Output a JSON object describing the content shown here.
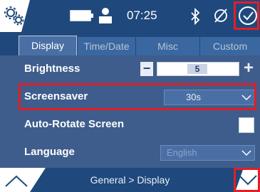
{
  "status_bar": {
    "time": "07:25",
    "icons": [
      "gears-icon",
      "battery-icon",
      "user-icon",
      "bluetooth-icon",
      "no-signal-icon",
      "check-circle-icon"
    ]
  },
  "tabs": [
    {
      "label": "Display",
      "active": true
    },
    {
      "label": "Time/Date",
      "active": false
    },
    {
      "label": "Misc",
      "active": false
    },
    {
      "label": "Custom",
      "active": false
    }
  ],
  "settings": {
    "brightness": {
      "label": "Brightness",
      "value": "5",
      "minus": "−",
      "plus": "+"
    },
    "screensaver": {
      "label": "Screensaver",
      "value": "30s"
    },
    "auto_rotate": {
      "label": "Auto-Rotate Screen",
      "checked": false
    },
    "language": {
      "label": "Language",
      "value": "English"
    }
  },
  "footer": {
    "breadcrumb": "General > Display"
  },
  "colors": {
    "header": "#1f497d",
    "panel": "#3e5d8c",
    "accent_red": "#e31e24"
  }
}
